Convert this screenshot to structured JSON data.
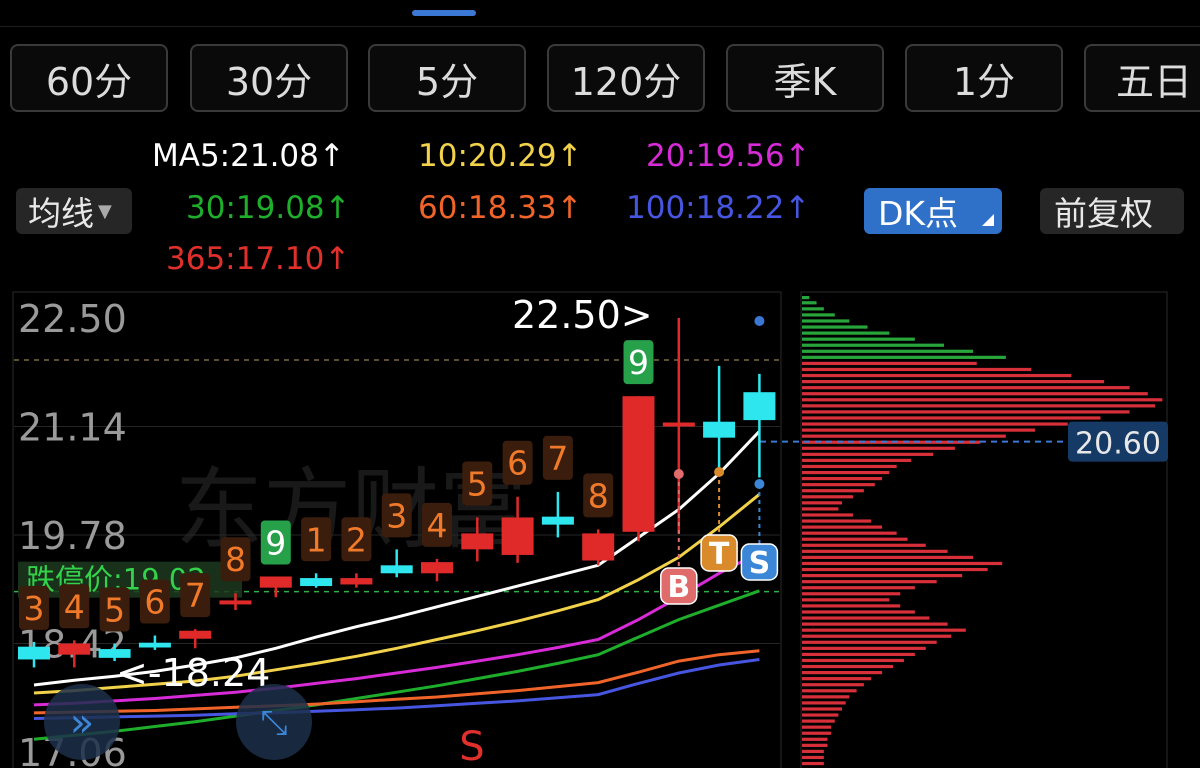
{
  "periods": [
    "60分",
    "30分",
    "5分",
    "120分",
    "季K",
    "1分",
    "五日"
  ],
  "ma_indicator": {
    "label": "均线",
    "items": [
      {
        "text": "MA5:21.08↑",
        "color": "#ffffff"
      },
      {
        "text": "10:20.29↑",
        "color": "#f2d24a"
      },
      {
        "text": "20:19.56↑",
        "color": "#d62bd6"
      },
      {
        "text": "30:19.08↑",
        "color": "#1fae2c"
      },
      {
        "text": "60:18.33↑",
        "color": "#f0642a"
      },
      {
        "text": "100:18.22↑",
        "color": "#4656e0"
      },
      {
        "text": "365:17.10↑",
        "color": "#e0302b"
      }
    ]
  },
  "dk_button": "DK点",
  "adjust_button": "前复权",
  "colors": {
    "up": "#e02a2a",
    "down": "#2ee6ee",
    "nine_label": "#f07a2a",
    "nine_box_bg": "#3a1d0c",
    "green_nine": "#27a04a"
  },
  "chart_data": {
    "type": "candlestick",
    "y_ticks": [
      "22.50",
      "21.14",
      "19.78",
      "18.42",
      "17.06"
    ],
    "ylim": [
      17.06,
      22.5
    ],
    "dashed_high_level": 22.5,
    "limit_down": {
      "label": "跌停价:19.02",
      "value": 19.02
    },
    "high_annotation": "22.50>",
    "low_annotation": "<-18.24",
    "current_price_label": "20.60",
    "current_price": 20.6,
    "candles": [
      {
        "o": 18.38,
        "h": 18.44,
        "l": 18.12,
        "c": 18.22,
        "count": "3"
      },
      {
        "o": 18.28,
        "h": 18.46,
        "l": 18.12,
        "c": 18.42,
        "count": "4"
      },
      {
        "o": 18.35,
        "h": 18.42,
        "l": 18.2,
        "c": 18.24,
        "count": "5"
      },
      {
        "o": 18.43,
        "h": 18.52,
        "l": 18.34,
        "c": 18.37,
        "count": "6"
      },
      {
        "o": 18.48,
        "h": 18.6,
        "l": 18.36,
        "c": 18.58,
        "count": "7"
      },
      {
        "o": 18.92,
        "h": 19.05,
        "l": 18.84,
        "c": 18.96,
        "count": "8"
      },
      {
        "o": 19.12,
        "h": 19.26,
        "l": 19.0,
        "c": 19.26,
        "count": "9"
      },
      {
        "o": 19.24,
        "h": 19.3,
        "l": 19.12,
        "c": 19.14,
        "count": "1"
      },
      {
        "o": 19.16,
        "h": 19.3,
        "l": 19.12,
        "c": 19.24,
        "count": "2"
      },
      {
        "o": 19.4,
        "h": 19.6,
        "l": 19.25,
        "c": 19.3,
        "count": "3"
      },
      {
        "o": 19.3,
        "h": 19.48,
        "l": 19.2,
        "c": 19.44,
        "count": "4"
      },
      {
        "o": 19.6,
        "h": 20.0,
        "l": 19.45,
        "c": 19.8,
        "count": "5"
      },
      {
        "o": 19.53,
        "h": 20.26,
        "l": 19.43,
        "c": 20.0,
        "count": "6"
      },
      {
        "o": 20.01,
        "h": 20.32,
        "l": 19.75,
        "c": 19.91,
        "count": "7"
      },
      {
        "o": 19.46,
        "h": 19.85,
        "l": 19.4,
        "c": 19.8,
        "count": "8"
      },
      {
        "o": 19.82,
        "h": 21.52,
        "l": 19.7,
        "c": 21.52,
        "count": "9"
      },
      {
        "o": 21.19,
        "h": 22.5,
        "l": 19.8,
        "c": 21.19,
        "count": ""
      },
      {
        "o": 21.2,
        "h": 21.9,
        "l": 20.6,
        "c": 21.0,
        "count": ""
      },
      {
        "o": 21.57,
        "h": 21.8,
        "l": 20.5,
        "c": 21.22,
        "count": ""
      }
    ],
    "series": [
      {
        "name": "MA5",
        "values": [
          17.9,
          17.96,
          18.01,
          18.07,
          18.15,
          18.24,
          18.36,
          18.5,
          18.63,
          18.75,
          18.88,
          19.01,
          19.14,
          19.27,
          19.4,
          19.75,
          20.1,
          20.55,
          21.08
        ]
      },
      {
        "name": "10",
        "values": [
          17.8,
          17.83,
          17.87,
          17.91,
          17.95,
          18.01,
          18.09,
          18.17,
          18.26,
          18.36,
          18.47,
          18.58,
          18.7,
          18.83,
          18.97,
          19.22,
          19.5,
          19.88,
          20.29
        ]
      },
      {
        "name": "20",
        "values": [
          17.65,
          17.67,
          17.7,
          17.73,
          17.77,
          17.81,
          17.86,
          17.92,
          17.98,
          18.05,
          18.12,
          18.2,
          18.28,
          18.37,
          18.47,
          18.72,
          19.0,
          19.3,
          19.56
        ]
      },
      {
        "name": "30",
        "values": [
          17.22,
          17.27,
          17.32,
          17.38,
          17.44,
          17.51,
          17.58,
          17.65,
          17.73,
          17.81,
          17.89,
          17.98,
          18.07,
          18.17,
          18.28,
          18.5,
          18.72,
          18.9,
          19.08
        ]
      },
      {
        "name": "60",
        "values": [
          17.55,
          17.56,
          17.57,
          17.58,
          17.6,
          17.62,
          17.64,
          17.66,
          17.69,
          17.72,
          17.75,
          17.79,
          17.83,
          17.88,
          17.93,
          18.06,
          18.2,
          18.28,
          18.33
        ]
      },
      {
        "name": "100",
        "values": [
          17.48,
          17.49,
          17.5,
          17.51,
          17.52,
          17.54,
          17.55,
          17.57,
          17.59,
          17.61,
          17.64,
          17.67,
          17.7,
          17.74,
          17.78,
          17.92,
          18.05,
          18.15,
          18.22
        ]
      }
    ],
    "signals": [
      {
        "label": "B",
        "index": 16,
        "price": 19.22
      },
      {
        "label": "T",
        "index": 17,
        "price": 19.35
      },
      {
        "label": "S",
        "index": 18,
        "price": 19.35
      }
    ],
    "bottom_signal": "S",
    "volume_profile": [
      {
        "price": 22.5,
        "len": 0.02,
        "c": "g"
      },
      {
        "price": 22.44,
        "len": 0.04,
        "c": "g"
      },
      {
        "price": 22.37,
        "len": 0.06,
        "c": "g"
      },
      {
        "price": 22.3,
        "len": 0.09,
        "c": "g"
      },
      {
        "price": 22.23,
        "len": 0.13,
        "c": "g"
      },
      {
        "price": 22.16,
        "len": 0.18,
        "c": "g"
      },
      {
        "price": 22.09,
        "len": 0.24,
        "c": "g"
      },
      {
        "price": 22.02,
        "len": 0.31,
        "c": "g"
      },
      {
        "price": 21.95,
        "len": 0.39,
        "c": "g"
      },
      {
        "price": 21.88,
        "len": 0.47,
        "c": "g"
      },
      {
        "price": 21.81,
        "len": 0.56,
        "c": "g"
      },
      {
        "price": 21.74,
        "len": 0.48,
        "c": "r"
      },
      {
        "price": 21.67,
        "len": 0.63,
        "c": "r"
      },
      {
        "price": 21.6,
        "len": 0.74,
        "c": "r"
      },
      {
        "price": 21.53,
        "len": 0.83,
        "c": "r"
      },
      {
        "price": 21.46,
        "len": 0.9,
        "c": "r"
      },
      {
        "price": 21.39,
        "len": 0.95,
        "c": "r"
      },
      {
        "price": 21.32,
        "len": 0.99,
        "c": "r"
      },
      {
        "price": 21.25,
        "len": 0.97,
        "c": "r"
      },
      {
        "price": 21.18,
        "len": 0.9,
        "c": "r"
      },
      {
        "price": 21.11,
        "len": 0.82,
        "c": "r"
      },
      {
        "price": 21.04,
        "len": 0.73,
        "c": "r"
      },
      {
        "price": 20.97,
        "len": 0.64,
        "c": "r"
      },
      {
        "price": 20.9,
        "len": 0.56,
        "c": "r"
      },
      {
        "price": 20.83,
        "len": 0.49,
        "c": "r"
      },
      {
        "price": 20.76,
        "len": 0.42,
        "c": "r"
      },
      {
        "price": 20.69,
        "len": 0.36,
        "c": "r"
      },
      {
        "price": 20.62,
        "len": 0.3,
        "c": "r"
      },
      {
        "price": 20.55,
        "len": 0.26,
        "c": "r"
      },
      {
        "price": 20.48,
        "len": 0.24,
        "c": "r"
      },
      {
        "price": 20.41,
        "len": 0.22,
        "c": "r"
      },
      {
        "price": 20.34,
        "len": 0.2,
        "c": "r"
      },
      {
        "price": 20.27,
        "len": 0.17,
        "c": "r"
      },
      {
        "price": 20.2,
        "len": 0.14,
        "c": "r"
      },
      {
        "price": 20.13,
        "len": 0.11,
        "c": "r"
      },
      {
        "price": 20.06,
        "len": 0.1,
        "c": "r"
      },
      {
        "price": 19.99,
        "len": 0.14,
        "c": "r"
      },
      {
        "price": 19.92,
        "len": 0.19,
        "c": "r"
      },
      {
        "price": 19.85,
        "len": 0.22,
        "c": "r"
      },
      {
        "price": 19.78,
        "len": 0.26,
        "c": "r"
      },
      {
        "price": 19.71,
        "len": 0.29,
        "c": "r"
      },
      {
        "price": 19.64,
        "len": 0.34,
        "c": "r"
      },
      {
        "price": 19.57,
        "len": 0.4,
        "c": "r"
      },
      {
        "price": 19.5,
        "len": 0.47,
        "c": "r"
      },
      {
        "price": 19.43,
        "len": 0.55,
        "c": "r"
      },
      {
        "price": 19.36,
        "len": 0.51,
        "c": "r"
      },
      {
        "price": 19.29,
        "len": 0.44,
        "c": "r"
      },
      {
        "price": 19.22,
        "len": 0.37,
        "c": "r"
      },
      {
        "price": 19.15,
        "len": 0.31,
        "c": "r"
      },
      {
        "price": 19.08,
        "len": 0.27,
        "c": "r"
      },
      {
        "price": 19.01,
        "len": 0.24,
        "c": "r"
      },
      {
        "price": 18.94,
        "len": 0.27,
        "c": "r"
      },
      {
        "price": 18.87,
        "len": 0.31,
        "c": "r"
      },
      {
        "price": 18.8,
        "len": 0.35,
        "c": "r"
      },
      {
        "price": 18.73,
        "len": 0.4,
        "c": "r"
      },
      {
        "price": 18.66,
        "len": 0.45,
        "c": "r"
      },
      {
        "price": 18.59,
        "len": 0.41,
        "c": "r"
      },
      {
        "price": 18.52,
        "len": 0.37,
        "c": "r"
      },
      {
        "price": 18.45,
        "len": 0.34,
        "c": "r"
      },
      {
        "price": 18.38,
        "len": 0.31,
        "c": "r"
      },
      {
        "price": 18.31,
        "len": 0.28,
        "c": "r"
      },
      {
        "price": 18.24,
        "len": 0.25,
        "c": "r"
      },
      {
        "price": 18.17,
        "len": 0.22,
        "c": "r"
      },
      {
        "price": 18.1,
        "len": 0.19,
        "c": "r"
      },
      {
        "price": 18.03,
        "len": 0.17,
        "c": "r"
      },
      {
        "price": 17.96,
        "len": 0.15,
        "c": "r"
      },
      {
        "price": 17.89,
        "len": 0.13,
        "c": "r"
      },
      {
        "price": 17.82,
        "len": 0.12,
        "c": "r"
      },
      {
        "price": 17.75,
        "len": 0.11,
        "c": "r"
      },
      {
        "price": 17.68,
        "len": 0.1,
        "c": "r"
      },
      {
        "price": 17.61,
        "len": 0.09,
        "c": "r"
      },
      {
        "price": 17.54,
        "len": 0.08,
        "c": "r"
      },
      {
        "price": 17.47,
        "len": 0.08,
        "c": "r"
      },
      {
        "price": 17.4,
        "len": 0.07,
        "c": "r"
      },
      {
        "price": 17.33,
        "len": 0.07,
        "c": "r"
      },
      {
        "price": 17.26,
        "len": 0.06,
        "c": "r"
      },
      {
        "price": 17.19,
        "len": 0.06,
        "c": "r"
      },
      {
        "price": 17.12,
        "len": 0.06,
        "c": "r"
      },
      {
        "price": 17.05,
        "len": 0.05,
        "c": "r"
      }
    ]
  }
}
